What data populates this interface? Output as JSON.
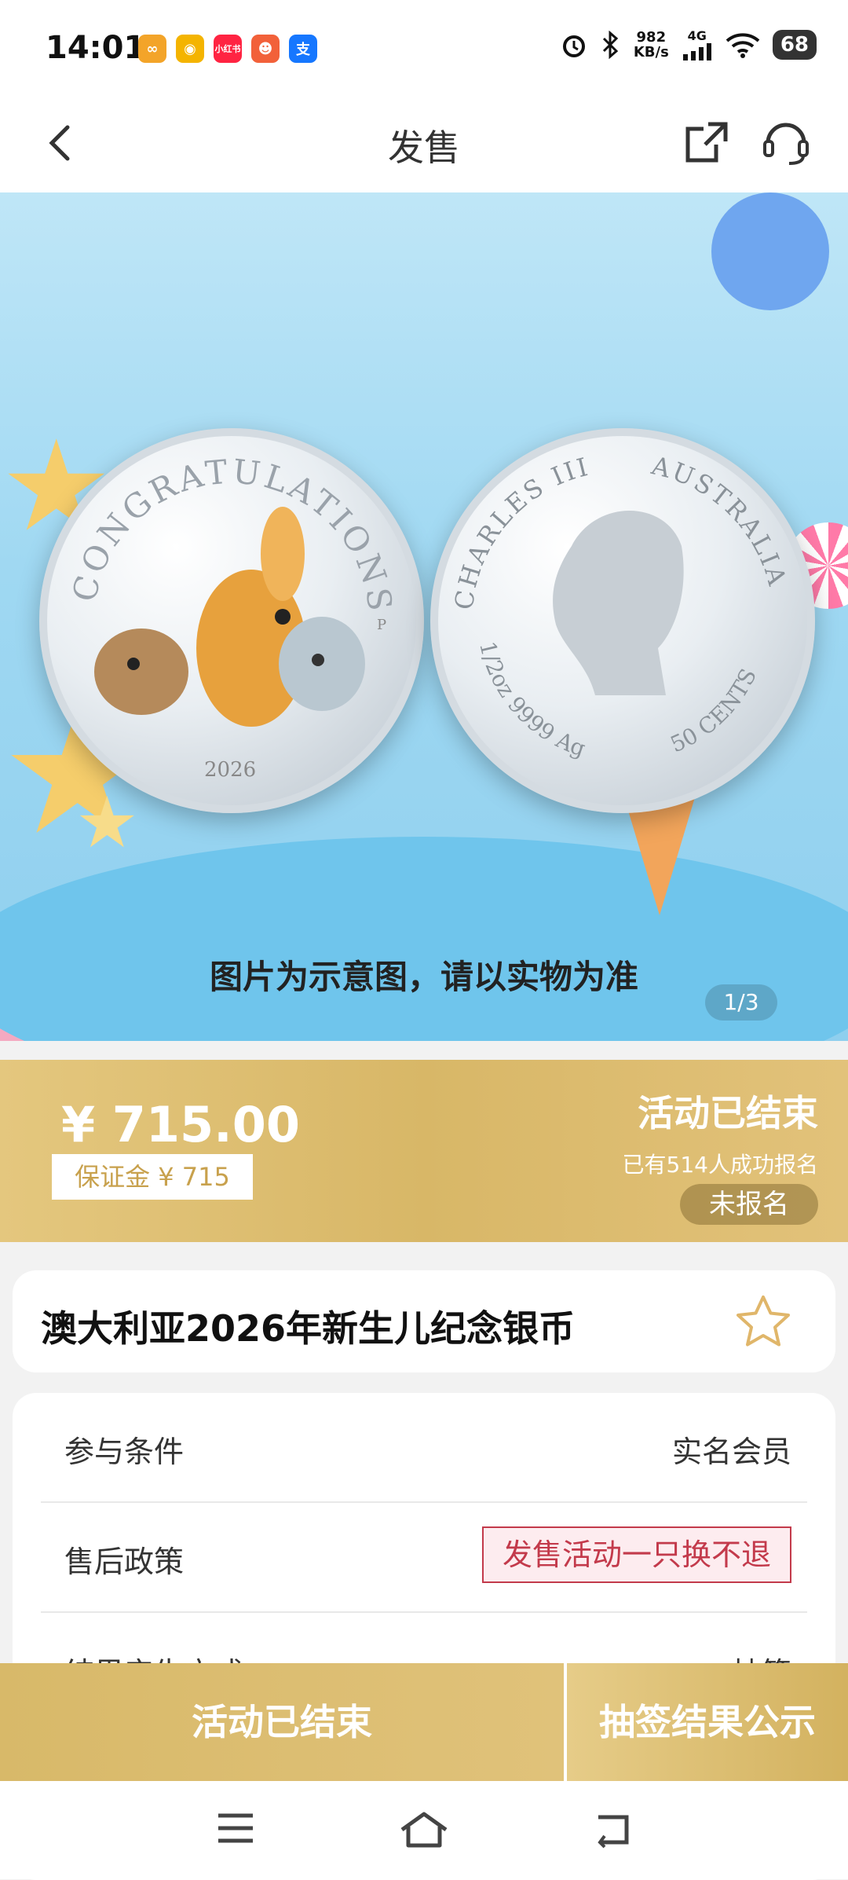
{
  "status_bar": {
    "time": "14:01",
    "net_speed_value": "982",
    "net_speed_unit": "KB/s",
    "signal": "4G",
    "battery": "68",
    "apps": [
      {
        "icon": "app-orange-icon",
        "color": "#f3a429",
        "label": ""
      },
      {
        "icon": "weibo-icon",
        "color": "#f4b400",
        "label": ""
      },
      {
        "icon": "xiaohongshu-icon",
        "color": "#ff2442",
        "label": "小红书"
      },
      {
        "icon": "app-pinduoduo-icon",
        "color": "#f2613a",
        "label": ""
      },
      {
        "icon": "alipay-icon",
        "color": "#1677ff",
        "label": "支"
      }
    ]
  },
  "nav": {
    "title": "发售"
  },
  "hero": {
    "caption": "图片为示意图，请以实物为准",
    "counter": "1/3",
    "coin_front": {
      "legend": "CONGRATULATIONS!",
      "year": "2026",
      "mint_mark": "P"
    },
    "coin_back": {
      "top_left": "CHARLES III",
      "top_right": "AUSTRALIA",
      "bottom_left": "1/2oz 9999 Ag",
      "bottom_right": "50 CENTS"
    }
  },
  "price_band": {
    "price": "¥ 715.00",
    "deposit": "保证金 ¥ 715",
    "status": "活动已结束",
    "signup_count": "已有514人成功报名",
    "signup_state": "未报名"
  },
  "product": {
    "title": "澳大利亚2026年新生儿纪念银币"
  },
  "info": {
    "rows": [
      {
        "label": "参与条件",
        "value": "实名会员"
      },
      {
        "label": "售后政策",
        "value": "发售活动一只换不退"
      },
      {
        "label": "结果产生方式",
        "value": "抽签"
      }
    ]
  },
  "actions": {
    "ended": "活动已结束",
    "result": "抽签结果公示"
  },
  "colors": {
    "gold": "#d8b767",
    "policy_red": "#c33a4b"
  }
}
